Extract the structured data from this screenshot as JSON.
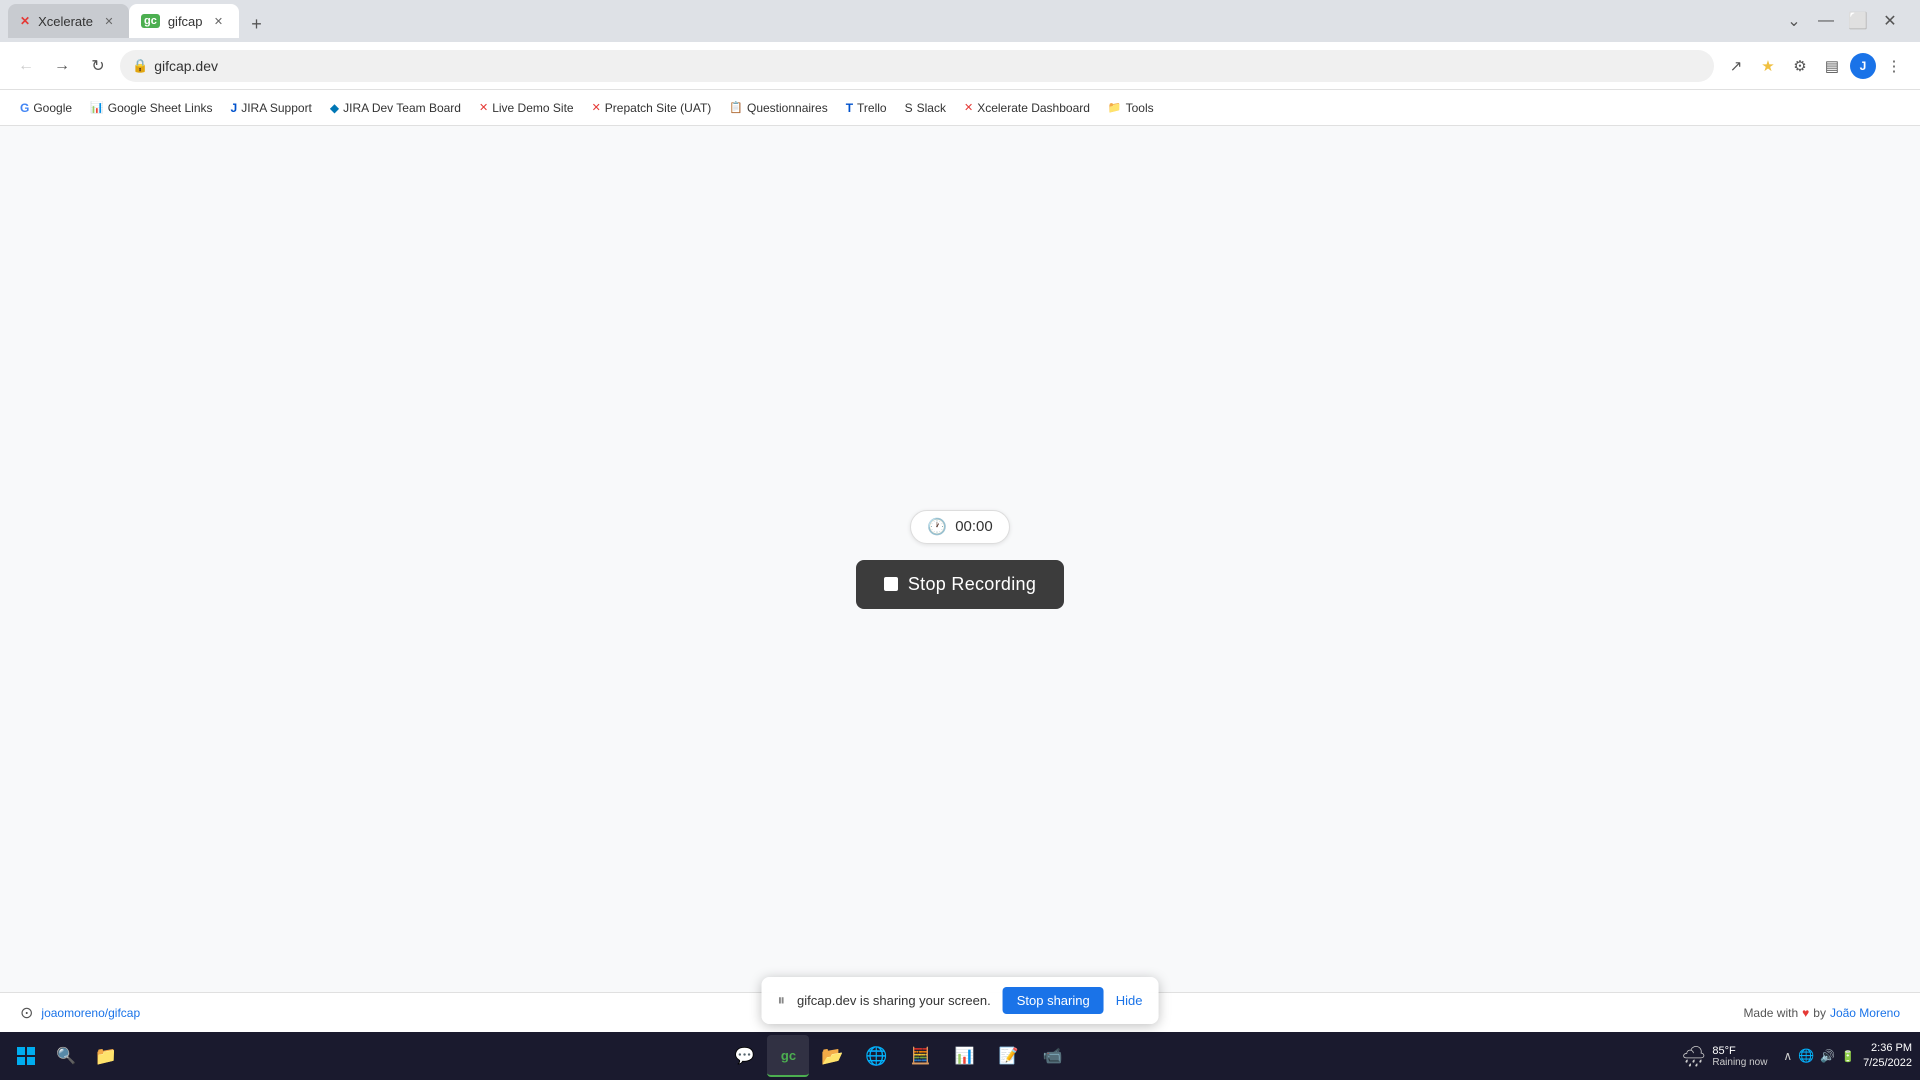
{
  "browser": {
    "tabs": [
      {
        "id": "xcelerate",
        "label": "Xcelerate",
        "favicon": "X",
        "active": false,
        "favicon_color": "#e53935"
      },
      {
        "id": "gifcap",
        "label": "gifcap",
        "favicon": "gc",
        "active": true,
        "favicon_color": "#4caf50"
      }
    ],
    "address": "gifcap.dev",
    "new_tab_label": "+"
  },
  "bookmarks": [
    {
      "label": "Google",
      "favicon": "G"
    },
    {
      "label": "Google Sheet Links",
      "favicon": "📊"
    },
    {
      "label": "JIRA Support",
      "favicon": "J"
    },
    {
      "label": "JIRA Dev Team Board",
      "favicon": "◆"
    },
    {
      "label": "Live Demo Site",
      "favicon": "✕"
    },
    {
      "label": "Prepatch Site (UAT)",
      "favicon": "✕"
    },
    {
      "label": "Questionnaires",
      "favicon": "📋"
    },
    {
      "label": "Trello",
      "favicon": "T"
    },
    {
      "label": "Slack",
      "favicon": "S"
    },
    {
      "label": "Xcelerate Dashboard",
      "favicon": "X"
    },
    {
      "label": "Tools",
      "favicon": "📁"
    }
  ],
  "recording": {
    "timer": "00:00",
    "stop_button_label": "Stop Recording"
  },
  "footer": {
    "github_handle": "joaomoreno/gifcap",
    "made_with_text": "Made with",
    "by_text": "by",
    "author": "João Moreno"
  },
  "screen_sharing": {
    "message": "gifcap.dev is sharing your screen.",
    "stop_sharing_label": "Stop sharing",
    "hide_label": "Hide"
  },
  "taskbar": {
    "time": "2:36 PM",
    "date": "7/25/2022",
    "weather_temp": "85°F",
    "weather_desc": "Raining now"
  }
}
